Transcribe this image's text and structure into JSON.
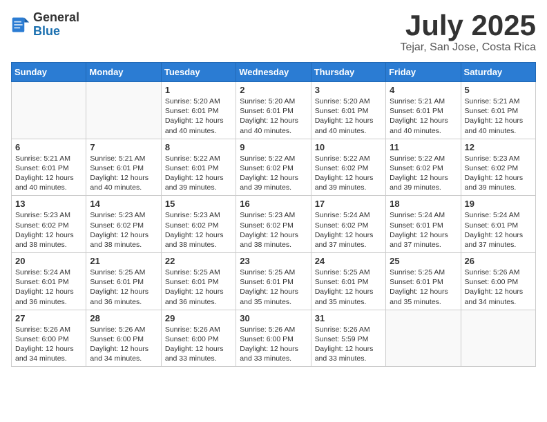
{
  "header": {
    "logo_general": "General",
    "logo_blue": "Blue",
    "month_title": "July 2025",
    "location": "Tejar, San Jose, Costa Rica"
  },
  "weekdays": [
    "Sunday",
    "Monday",
    "Tuesday",
    "Wednesday",
    "Thursday",
    "Friday",
    "Saturday"
  ],
  "weeks": [
    [
      {
        "day": "",
        "sunrise": "",
        "sunset": "",
        "daylight": ""
      },
      {
        "day": "",
        "sunrise": "",
        "sunset": "",
        "daylight": ""
      },
      {
        "day": "1",
        "sunrise": "Sunrise: 5:20 AM",
        "sunset": "Sunset: 6:01 PM",
        "daylight": "Daylight: 12 hours and 40 minutes."
      },
      {
        "day": "2",
        "sunrise": "Sunrise: 5:20 AM",
        "sunset": "Sunset: 6:01 PM",
        "daylight": "Daylight: 12 hours and 40 minutes."
      },
      {
        "day": "3",
        "sunrise": "Sunrise: 5:20 AM",
        "sunset": "Sunset: 6:01 PM",
        "daylight": "Daylight: 12 hours and 40 minutes."
      },
      {
        "day": "4",
        "sunrise": "Sunrise: 5:21 AM",
        "sunset": "Sunset: 6:01 PM",
        "daylight": "Daylight: 12 hours and 40 minutes."
      },
      {
        "day": "5",
        "sunrise": "Sunrise: 5:21 AM",
        "sunset": "Sunset: 6:01 PM",
        "daylight": "Daylight: 12 hours and 40 minutes."
      }
    ],
    [
      {
        "day": "6",
        "sunrise": "Sunrise: 5:21 AM",
        "sunset": "Sunset: 6:01 PM",
        "daylight": "Daylight: 12 hours and 40 minutes."
      },
      {
        "day": "7",
        "sunrise": "Sunrise: 5:21 AM",
        "sunset": "Sunset: 6:01 PM",
        "daylight": "Daylight: 12 hours and 40 minutes."
      },
      {
        "day": "8",
        "sunrise": "Sunrise: 5:22 AM",
        "sunset": "Sunset: 6:01 PM",
        "daylight": "Daylight: 12 hours and 39 minutes."
      },
      {
        "day": "9",
        "sunrise": "Sunrise: 5:22 AM",
        "sunset": "Sunset: 6:02 PM",
        "daylight": "Daylight: 12 hours and 39 minutes."
      },
      {
        "day": "10",
        "sunrise": "Sunrise: 5:22 AM",
        "sunset": "Sunset: 6:02 PM",
        "daylight": "Daylight: 12 hours and 39 minutes."
      },
      {
        "day": "11",
        "sunrise": "Sunrise: 5:22 AM",
        "sunset": "Sunset: 6:02 PM",
        "daylight": "Daylight: 12 hours and 39 minutes."
      },
      {
        "day": "12",
        "sunrise": "Sunrise: 5:23 AM",
        "sunset": "Sunset: 6:02 PM",
        "daylight": "Daylight: 12 hours and 39 minutes."
      }
    ],
    [
      {
        "day": "13",
        "sunrise": "Sunrise: 5:23 AM",
        "sunset": "Sunset: 6:02 PM",
        "daylight": "Daylight: 12 hours and 38 minutes."
      },
      {
        "day": "14",
        "sunrise": "Sunrise: 5:23 AM",
        "sunset": "Sunset: 6:02 PM",
        "daylight": "Daylight: 12 hours and 38 minutes."
      },
      {
        "day": "15",
        "sunrise": "Sunrise: 5:23 AM",
        "sunset": "Sunset: 6:02 PM",
        "daylight": "Daylight: 12 hours and 38 minutes."
      },
      {
        "day": "16",
        "sunrise": "Sunrise: 5:23 AM",
        "sunset": "Sunset: 6:02 PM",
        "daylight": "Daylight: 12 hours and 38 minutes."
      },
      {
        "day": "17",
        "sunrise": "Sunrise: 5:24 AM",
        "sunset": "Sunset: 6:02 PM",
        "daylight": "Daylight: 12 hours and 37 minutes."
      },
      {
        "day": "18",
        "sunrise": "Sunrise: 5:24 AM",
        "sunset": "Sunset: 6:01 PM",
        "daylight": "Daylight: 12 hours and 37 minutes."
      },
      {
        "day": "19",
        "sunrise": "Sunrise: 5:24 AM",
        "sunset": "Sunset: 6:01 PM",
        "daylight": "Daylight: 12 hours and 37 minutes."
      }
    ],
    [
      {
        "day": "20",
        "sunrise": "Sunrise: 5:24 AM",
        "sunset": "Sunset: 6:01 PM",
        "daylight": "Daylight: 12 hours and 36 minutes."
      },
      {
        "day": "21",
        "sunrise": "Sunrise: 5:25 AM",
        "sunset": "Sunset: 6:01 PM",
        "daylight": "Daylight: 12 hours and 36 minutes."
      },
      {
        "day": "22",
        "sunrise": "Sunrise: 5:25 AM",
        "sunset": "Sunset: 6:01 PM",
        "daylight": "Daylight: 12 hours and 36 minutes."
      },
      {
        "day": "23",
        "sunrise": "Sunrise: 5:25 AM",
        "sunset": "Sunset: 6:01 PM",
        "daylight": "Daylight: 12 hours and 35 minutes."
      },
      {
        "day": "24",
        "sunrise": "Sunrise: 5:25 AM",
        "sunset": "Sunset: 6:01 PM",
        "daylight": "Daylight: 12 hours and 35 minutes."
      },
      {
        "day": "25",
        "sunrise": "Sunrise: 5:25 AM",
        "sunset": "Sunset: 6:01 PM",
        "daylight": "Daylight: 12 hours and 35 minutes."
      },
      {
        "day": "26",
        "sunrise": "Sunrise: 5:26 AM",
        "sunset": "Sunset: 6:00 PM",
        "daylight": "Daylight: 12 hours and 34 minutes."
      }
    ],
    [
      {
        "day": "27",
        "sunrise": "Sunrise: 5:26 AM",
        "sunset": "Sunset: 6:00 PM",
        "daylight": "Daylight: 12 hours and 34 minutes."
      },
      {
        "day": "28",
        "sunrise": "Sunrise: 5:26 AM",
        "sunset": "Sunset: 6:00 PM",
        "daylight": "Daylight: 12 hours and 34 minutes."
      },
      {
        "day": "29",
        "sunrise": "Sunrise: 5:26 AM",
        "sunset": "Sunset: 6:00 PM",
        "daylight": "Daylight: 12 hours and 33 minutes."
      },
      {
        "day": "30",
        "sunrise": "Sunrise: 5:26 AM",
        "sunset": "Sunset: 6:00 PM",
        "daylight": "Daylight: 12 hours and 33 minutes."
      },
      {
        "day": "31",
        "sunrise": "Sunrise: 5:26 AM",
        "sunset": "Sunset: 5:59 PM",
        "daylight": "Daylight: 12 hours and 33 minutes."
      },
      {
        "day": "",
        "sunrise": "",
        "sunset": "",
        "daylight": ""
      },
      {
        "day": "",
        "sunrise": "",
        "sunset": "",
        "daylight": ""
      }
    ]
  ]
}
